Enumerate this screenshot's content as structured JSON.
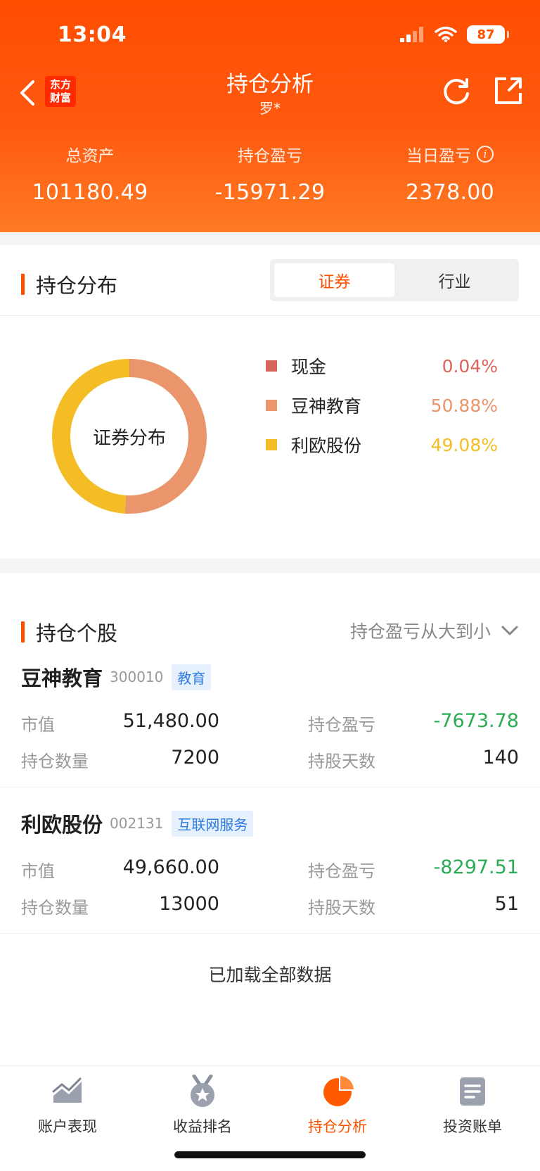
{
  "status_bar": {
    "time": "13:04",
    "battery": "87"
  },
  "nav": {
    "title": "持仓分析",
    "subtitle": "罗*",
    "logo_text": "东方财富"
  },
  "summary": [
    {
      "label": "总资产",
      "value": "101180.49"
    },
    {
      "label": "持仓盈亏",
      "value": "-15971.29"
    },
    {
      "label": "当日盈亏",
      "value": "2378.00"
    }
  ],
  "distribution": {
    "title": "持仓分布",
    "tabs": [
      {
        "label": "证券",
        "active": true
      },
      {
        "label": "行业",
        "active": false
      }
    ],
    "center_label": "证券分布",
    "items": [
      {
        "name": "现金",
        "pct": "0.04%",
        "value": 0.04,
        "color": "#d9665a"
      },
      {
        "name": "豆神教育",
        "pct": "50.88%",
        "value": 50.88,
        "color": "#ea956b"
      },
      {
        "name": "利欧股份",
        "pct": "49.08%",
        "value": 49.08,
        "color": "#f4bd26"
      }
    ]
  },
  "holdings": {
    "title": "持仓个股",
    "sort_label": "持仓盈亏从大到小",
    "labels": {
      "market_value": "市值",
      "pnl": "持仓盈亏",
      "quantity": "持仓数量",
      "days": "持股天数"
    },
    "stocks": [
      {
        "name": "豆神教育",
        "code": "300010",
        "tag": "教育",
        "market_value": "51,480.00",
        "pnl": "-7673.78",
        "quantity": "7200",
        "days": "140"
      },
      {
        "name": "利欧股份",
        "code": "002131",
        "tag": "互联网服务",
        "market_value": "49,660.00",
        "pnl": "-8297.51",
        "quantity": "13000",
        "days": "51"
      }
    ],
    "footer": "已加载全部数据"
  },
  "tabbar": [
    {
      "label": "账户表现",
      "icon": "chart-trend-icon",
      "active": false
    },
    {
      "label": "收益排名",
      "icon": "medal-icon",
      "active": false
    },
    {
      "label": "持仓分析",
      "icon": "pie-chart-icon",
      "active": true
    },
    {
      "label": "投资账单",
      "icon": "bill-icon",
      "active": false
    }
  ],
  "colors": {
    "brand": "#ff5000",
    "loss": "#2bab56",
    "tag_blue": "#2d7bdf"
  }
}
